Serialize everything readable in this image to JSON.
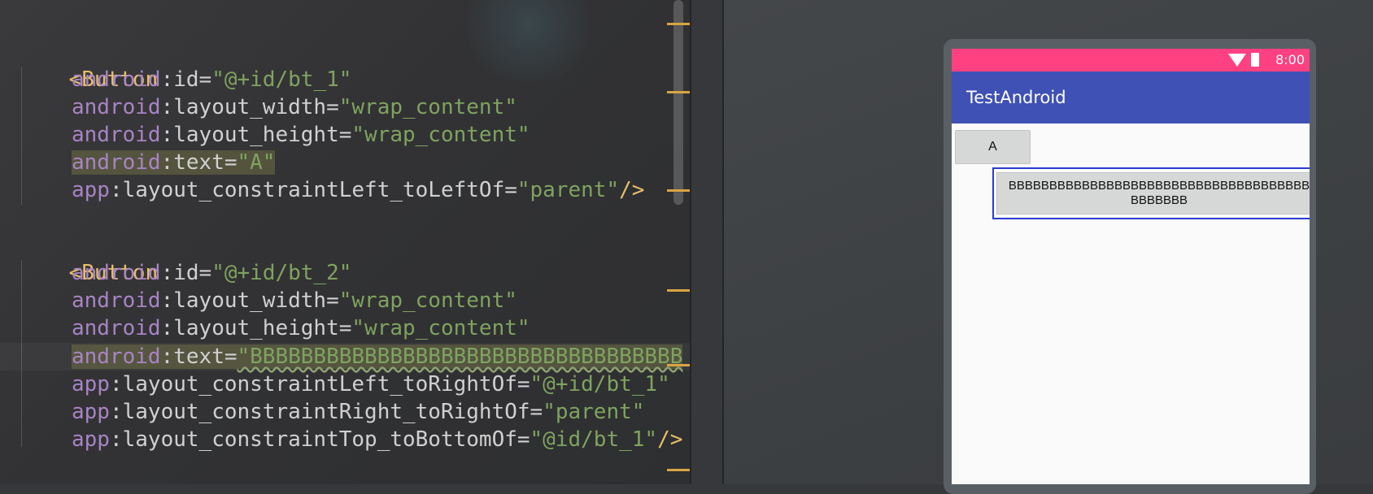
{
  "editor": {
    "block1": {
      "open_tag": "<Button",
      "lines": [
        {
          "ns": "android",
          "attr": ":id=",
          "val": "\"@+id/bt_1\"",
          "tail": ""
        },
        {
          "ns": "android",
          "attr": ":layout_width=",
          "val": "\"wrap_content\"",
          "tail": ""
        },
        {
          "ns": "android",
          "attr": ":layout_height=",
          "val": "\"wrap_content\"",
          "tail": ""
        },
        {
          "ns": "android",
          "attr": ":text=",
          "val": "\"A\"",
          "tail": ""
        },
        {
          "ns": "app",
          "attr": ":layout_constraintLeft_toLeftOf=",
          "val": "\"parent\"",
          "tail": "/>"
        }
      ]
    },
    "block2": {
      "open_tag": "<Button",
      "lines": [
        {
          "ns": "android",
          "attr": ":id=",
          "val": "\"@+id/bt_2\"",
          "tail": ""
        },
        {
          "ns": "android",
          "attr": ":layout_width=",
          "val": "\"wrap_content\"",
          "tail": ""
        },
        {
          "ns": "android",
          "attr": ":layout_height=",
          "val": "\"wrap_content\"",
          "tail": ""
        },
        {
          "ns": "android",
          "attr": ":text=",
          "val": "\"BBBBBBBBBBBBBBBBBBBBBBBBBBBBBBBBBB",
          "tail": ""
        },
        {
          "ns": "app",
          "attr": ":layout_constraintLeft_toRightOf=",
          "val": "\"@+id/bt_1\"",
          "tail": ""
        },
        {
          "ns": "app",
          "attr": ":layout_constraintRight_toRightOf=",
          "val": "\"parent\"",
          "tail": ""
        },
        {
          "ns": "app",
          "attr": ":layout_constraintTop_toBottomOf=",
          "val": "\"@id/bt_1\"",
          "tail": "/>"
        }
      ]
    }
  },
  "preview": {
    "status_time": "8:00",
    "app_title": "TestAndroid",
    "button_a_label": "A",
    "button_b_line1": "BBBBBBBBBBBBBBBBBBBBBBBBBBBBBBBBBBBBB",
    "button_b_line2": "BBBBBBB"
  },
  "colors": {
    "status_bar": "#ff4081",
    "app_bar": "#3f51b5",
    "selection_frame": "#2b3bd4",
    "xml_tag": "#e8bf6a",
    "xml_namespace": "#a884c4",
    "xml_value": "#7fa35f"
  },
  "icons": {
    "status_bar": [
      "wifi-icon",
      "battery-icon"
    ]
  }
}
